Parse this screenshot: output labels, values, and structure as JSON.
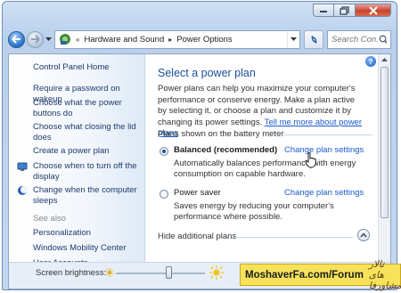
{
  "window": {
    "caption_buttons": [
      "minimize",
      "maximize",
      "close"
    ]
  },
  "navigation": {
    "breadcrumb": [
      "Hardware and Sound",
      "Power Options"
    ],
    "search_placeholder": "Search Con..."
  },
  "sidebar": {
    "home": "Control Panel Home",
    "items": [
      "Require a password on wakeup",
      "Choose what the power buttons do",
      "Choose what closing the lid does",
      "Create a power plan",
      "Choose when to turn off the display",
      "Change when the computer sleeps"
    ],
    "see_also_label": "See also",
    "see_also": [
      "Personalization",
      "Windows Mobility Center",
      "User Accounts"
    ]
  },
  "main": {
    "title": "Select a power plan",
    "intro": "Power plans can help you maximize your computer's performance or conserve energy. Make a plan active by selecting it, or choose a plan and customize it by changing its power settings.",
    "intro_link": "Tell me more about power plans",
    "section_label": "Plans shown on the battery meter",
    "plans": [
      {
        "name": "Balanced (recommended)",
        "selected": true,
        "link": "Change plan settings",
        "description": "Automatically balances performance with energy consumption on capable hardware."
      },
      {
        "name": "Power saver",
        "selected": false,
        "link": "Change plan settings",
        "description": "Saves energy by reducing your computer's performance where possible."
      }
    ],
    "hide_label": "Hide additional plans",
    "brightness_label": "Screen brightness:",
    "brightness_level": 0.6
  },
  "watermark": {
    "english": "MoshaverFa.com/Forum",
    "persian": "تالار های مشاورفا"
  },
  "colors": {
    "link": "#1a5ccc",
    "title": "#1c4f9c",
    "watermark_bg": "#f7e35a"
  }
}
